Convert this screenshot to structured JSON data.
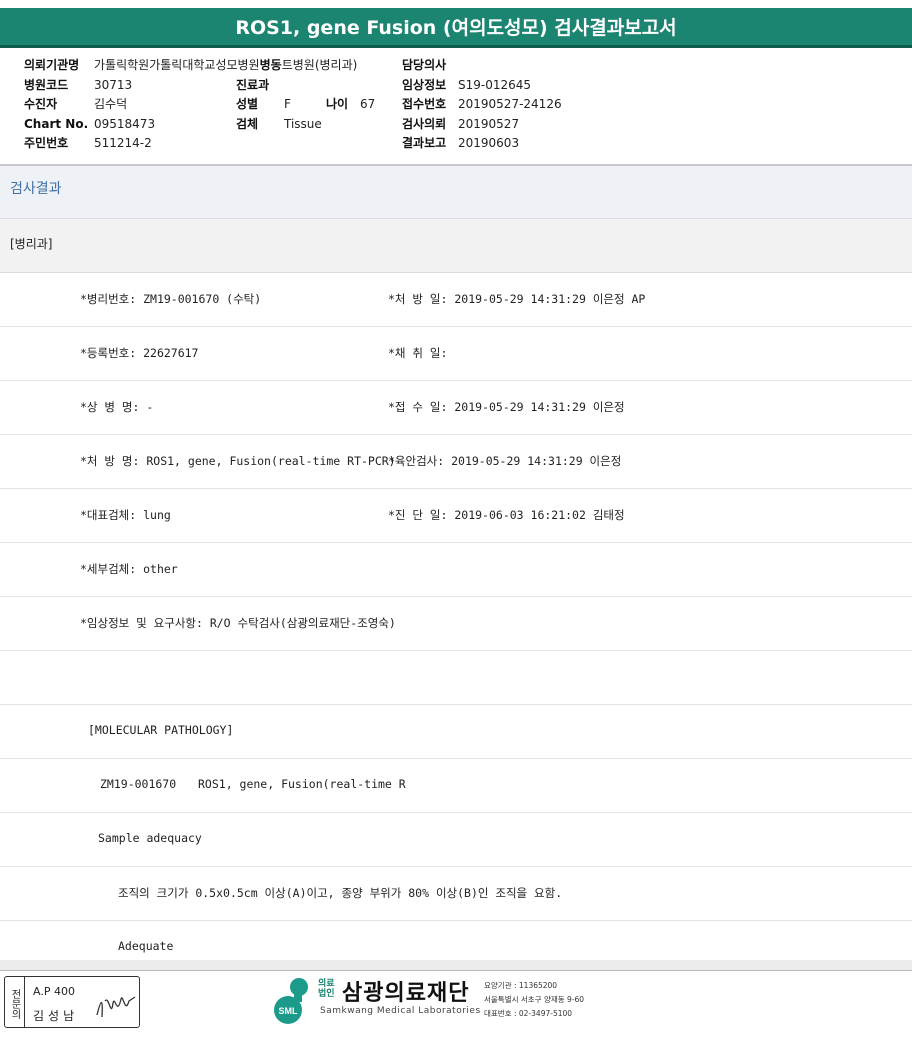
{
  "title": "ROS1, gene Fusion (여의도성모) 검사결과보고서",
  "info": {
    "col1": [
      {
        "k": "의뢰기관명",
        "v": "가톨릭학원가톨릭대학교성모병원"
      },
      {
        "k": "병원코드",
        "v": "30713"
      },
      {
        "k": "수진자",
        "v": "김수덕"
      },
      {
        "k": "Chart No.",
        "v": "09518473"
      },
      {
        "k": "주민번호",
        "v": "511214-2"
      }
    ],
    "ward": {
      "k": "병동",
      "v": "트병원(병리과)"
    },
    "clinic": {
      "k": "진료과",
      "v": ""
    },
    "sex": {
      "k": "성별",
      "v": "F"
    },
    "age": {
      "k": "나이",
      "v": "67"
    },
    "specimen": {
      "k": "검체",
      "v": "Tissue"
    },
    "col3": [
      {
        "k": "담당의사",
        "v": ""
      },
      {
        "k": "임상정보",
        "v": "S19-012645"
      },
      {
        "k": "접수번호",
        "v": "20190527-24126"
      },
      {
        "k": "검사의뢰",
        "v": "20190527"
      },
      {
        "k": "결과보고",
        "v": "20190603"
      }
    ]
  },
  "result_header": "검사결과",
  "department": "[병리과]",
  "lines": {
    "pathology_no": "*병리번호: ZM19-001670 (수탁)",
    "prescribed_at": "*처 방 일: 2019-05-29 14:31:29  이은정 AP",
    "reg_no": "*등록번호: 22627617",
    "collected_at": "*채 취 일:",
    "disease_name": "*상 병 명: -",
    "received_at": "*접 수 일: 2019-05-29 14:31:29  이은정",
    "order_name": "*처 방 명: ROS1, gene, Fusion(real-time RT-PCR)",
    "gross_exam": "*육안검사: 2019-05-29 14:31:29  이은정",
    "rep_specimen": "*대표검체: lung",
    "diagnosed_at": "*진 단 일: 2019-06-03 16:21:02  김태정",
    "sub_specimen": "*세부검체: other",
    "clinical_request": "*임상정보 및 요구사항: R/O 수탁검사(삼광의료재단-조영숙)",
    "mol_header": "[MOLECULAR PATHOLOGY]",
    "zm_code": "ZM19-001670",
    "zm_test": "ROS1, gene, Fusion(real-time R",
    "sample_adequacy": "Sample adequacy",
    "criteria": "조직의 크기가 0.5x0.5cm 이상(A)이고, 종양 부위가 80% 이상(B)인 조직을 요함.",
    "adequate": "Adequate"
  },
  "stamp": {
    "vertical": "전문의",
    "ap": "A.P 400",
    "name": "김성남"
  },
  "logo": {
    "corp": "의료법인",
    "korean_name": "삼광의료재단",
    "english_name": "Samkwang Medical Laboratories",
    "mark_text": "SML",
    "care_code": "요양기관 : 11365200",
    "address": "서울특별시 서초구 양재동 9-60",
    "phone": "대표번호 : 02-3497-5100"
  },
  "colors": {
    "title_bg": "#1c8571",
    "result_header_text": "#3f6fa3"
  }
}
